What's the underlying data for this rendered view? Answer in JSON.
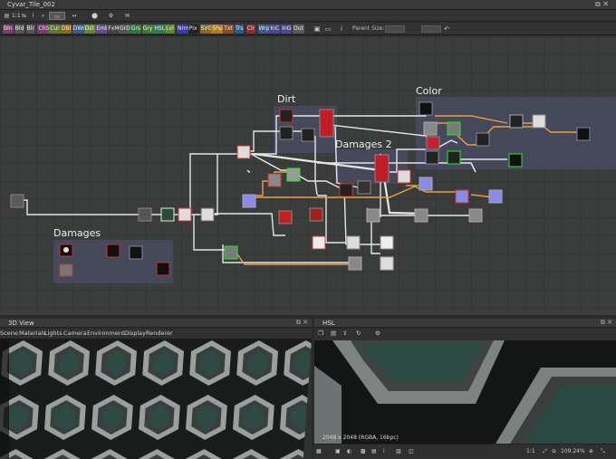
{
  "window": {
    "title": "Cyvar_Tile_002",
    "controls": "⧉ ✕"
  },
  "toolbar1": {
    "buttons": [
      "▤",
      "⇆",
      "i",
      "⌕",
      "▭",
      "↔",
      "⬤",
      "⚙",
      "✉"
    ],
    "ratio": "1:1"
  },
  "toolbar2": {
    "chips": [
      {
        "label": "Bln",
        "color": "#7a3c6e"
      },
      {
        "label": "Bld",
        "color": "#555555"
      },
      {
        "label": "Blr",
        "color": "#555555"
      },
      {
        "label": "ChS",
        "color": "#7a3c6e"
      },
      {
        "label": "Cur",
        "color": "#5f7a2e"
      },
      {
        "label": "DBl",
        "color": "#8a6a1a"
      },
      {
        "label": "DWr",
        "color": "#3a5c8a"
      },
      {
        "label": "Dst",
        "color": "#5f8a2e"
      },
      {
        "label": "Emb",
        "color": "#6a4a8a"
      },
      {
        "label": "FxM",
        "color": "#444444"
      },
      {
        "label": "GrD",
        "color": "#555555"
      },
      {
        "label": "Grs",
        "color": "#2e7a3a"
      },
      {
        "label": "Gry",
        "color": "#3a7a3a"
      },
      {
        "label": "HSL",
        "color": "#2e7a5a"
      },
      {
        "label": "Lvl",
        "color": "#5a8a2e"
      },
      {
        "label": "Nrm",
        "color": "#3a3aa0"
      },
      {
        "label": "Pix",
        "color": "#222222"
      },
      {
        "label": "SVG",
        "color": "#8a6a1a"
      },
      {
        "label": "Shp",
        "color": "#b07a1a"
      },
      {
        "label": "Txt",
        "color": "#8a4a2a"
      },
      {
        "label": "Trs",
        "color": "#2e5a8a"
      },
      {
        "label": "Clr",
        "color": "#8a2e2e"
      },
      {
        "label": "Wrp",
        "color": "#3a5a8a"
      },
      {
        "label": "InC",
        "color": "#4a4a8a"
      },
      {
        "label": "InG",
        "color": "#4a4a8a"
      },
      {
        "label": "Out",
        "color": "#5a5a5a"
      }
    ],
    "parent_size_label": "Parent Size:",
    "icon_names": [
      "frame-icon",
      "comment-icon",
      "info-icon",
      "undo-icon"
    ]
  },
  "graph": {
    "frames": [
      {
        "label": "Dirt"
      },
      {
        "label": "Color"
      },
      {
        "label": "Damages 2"
      },
      {
        "label": "Damages"
      }
    ]
  },
  "panel_3d": {
    "title": "3D View",
    "menu": [
      "Scene",
      "Materials",
      "Lights",
      "Camera",
      "Environment",
      "Display",
      "Renderer"
    ]
  },
  "panel_hsl": {
    "title": "HSL",
    "resolution": "2048 x 2048 (RGBA, 16bpc)",
    "ratio": "1:1",
    "zoom": "109.24%"
  }
}
